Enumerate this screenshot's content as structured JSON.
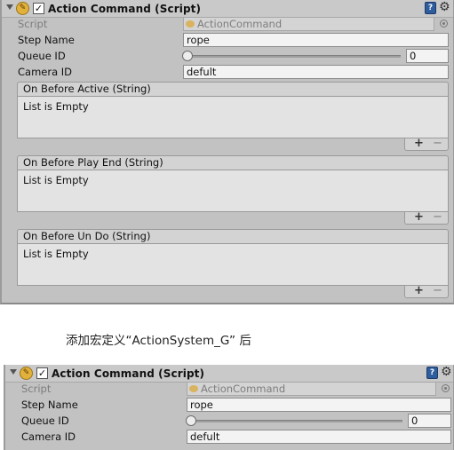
{
  "component": {
    "title": "Action Command (Script)",
    "enabled": true
  },
  "fields": {
    "script_label": "Script",
    "script_value": "ActionCommand",
    "step_name_label": "Step Name",
    "step_name_value": "rope",
    "queue_id_label": "Queue ID",
    "queue_id_value": "0",
    "queue_id_slider_level": 0,
    "camera_id_label": "Camera ID",
    "camera_id_value": "defult"
  },
  "lists": [
    {
      "title": "On Before Active (String)",
      "empty_text": "List is Empty",
      "add": "+",
      "remove": "−"
    },
    {
      "title": "On Before Play End (String)",
      "empty_text": "List is Empty",
      "add": "+",
      "remove": "−"
    },
    {
      "title": "On Before Un Do (String)",
      "empty_text": "List is Empty",
      "add": "+",
      "remove": "−"
    }
  ],
  "caption": "添加宏定义“ActionSystem_G” 后",
  "icons": {
    "foldout": "foldout-triangle-icon",
    "script": "script-icon",
    "help": "help-book-icon",
    "settings": "gear-icon",
    "object_picker": "object-picker-icon"
  },
  "colors": {
    "inspector_bg": "#c2c2c2",
    "header_bg": "#c9c9c9",
    "list_bg": "#e3e3e3",
    "help_blue": "#2e5d9e"
  }
}
